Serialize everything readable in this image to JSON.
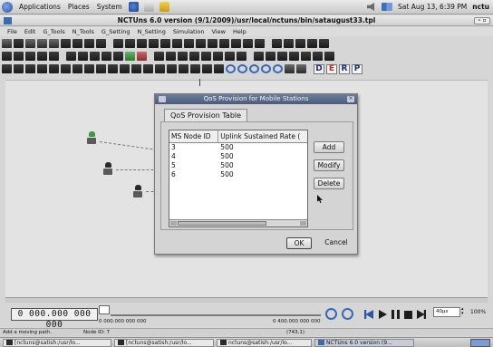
{
  "top_panel": {
    "menus": [
      "Applications",
      "Places",
      "System"
    ],
    "clock": "Sat Aug 13,  6:39 PM",
    "user": "nctu"
  },
  "window": {
    "title": "NCTUns 6.0 version (9/1/2009)/usr/local/nctuns/bin/sataugust33.tpl"
  },
  "menubar": {
    "items": [
      "File",
      "Edit",
      "G_Tools",
      "N_Tools",
      "G_Setting",
      "N_Setting",
      "Simulation",
      "View",
      "Help"
    ]
  },
  "toolbar": {
    "mode_buttons": [
      "D",
      "E",
      "R",
      "P"
    ]
  },
  "dialog": {
    "title": "QoS Provision for Mobile Stations",
    "tab_label": "QoS Provision Table",
    "table": {
      "headers": [
        "MS Node ID",
        "Uplink Sustained Rate ("
      ],
      "rows": [
        [
          "3",
          "500"
        ],
        [
          "4",
          "500"
        ],
        [
          "5",
          "500"
        ],
        [
          "6",
          "500"
        ]
      ]
    },
    "buttons": {
      "add": "Add",
      "modify": "Modify",
      "delete": "Delete",
      "ok": "OK",
      "cancel": "Cancel"
    }
  },
  "timebar": {
    "time_display": "0 000.000 000 000",
    "timeline_start": "0 000.000 000 000",
    "timeline_end": "0 400.000 000 000",
    "step": "40µs",
    "zoom": "100%"
  },
  "statusbar": {
    "message": "Add a moving path.",
    "node_id": "Node ID: 7",
    "coords": "(743,1)"
  },
  "taskbar": {
    "tasks": [
      "[nctuns@satish:/usr/lo...",
      "[nctuns@satish:/usr/lo...",
      "nctuns@satish:/usr/lo...",
      "NCTUns 6.0 version (9..."
    ]
  }
}
